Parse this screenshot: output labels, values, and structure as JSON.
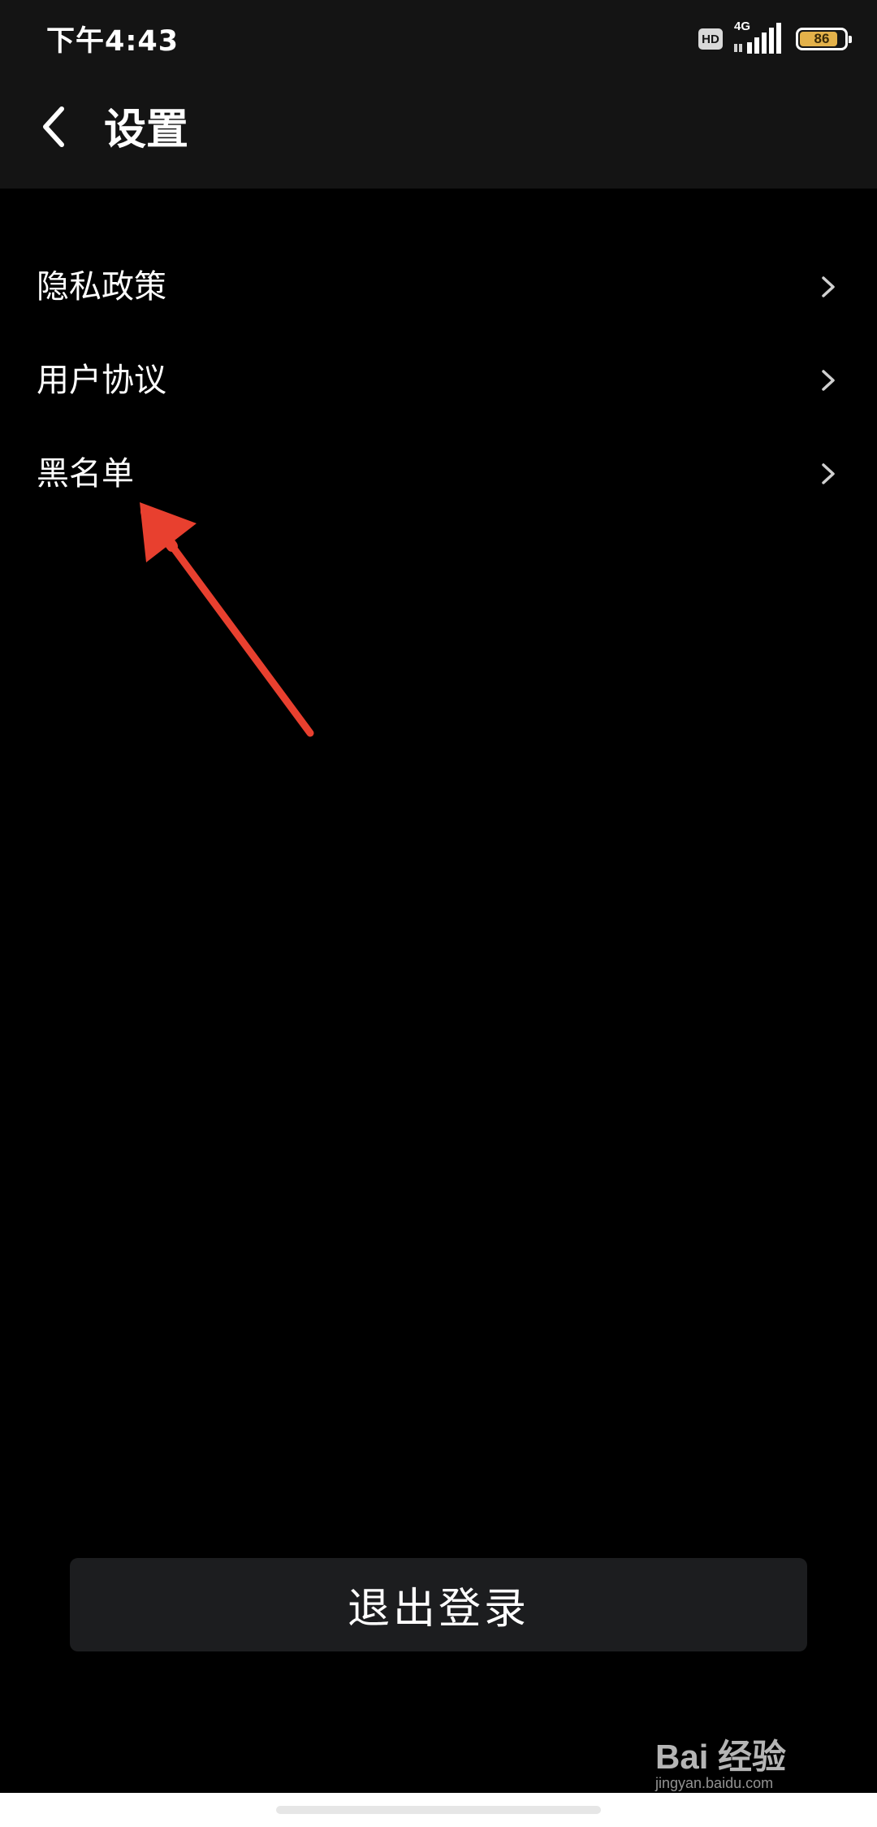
{
  "status_bar": {
    "time": "下午4:43",
    "hd_label": "HD",
    "network_label": "4G",
    "battery_level": "86",
    "battery_percent": 86,
    "battery_color": "#e3b14a"
  },
  "header": {
    "title": "设置",
    "back_icon": "chevron-left-icon"
  },
  "menu": {
    "items": [
      {
        "label": "隐私政策",
        "icon": "chevron-right-icon"
      },
      {
        "label": "用户协议",
        "icon": "chevron-right-icon"
      },
      {
        "label": "黑名单",
        "icon": "chevron-right-icon"
      }
    ]
  },
  "annotation": {
    "color": "#e8402f",
    "target": "黑名单"
  },
  "logout": {
    "label": "退出登录"
  },
  "watermark": {
    "main": "Bai 经验",
    "sub": "jingyan.baidu.com"
  },
  "theme": {
    "background": "#000000",
    "header_background": "#141414",
    "button_background": "#1c1d1f",
    "text": "#ffffff"
  }
}
